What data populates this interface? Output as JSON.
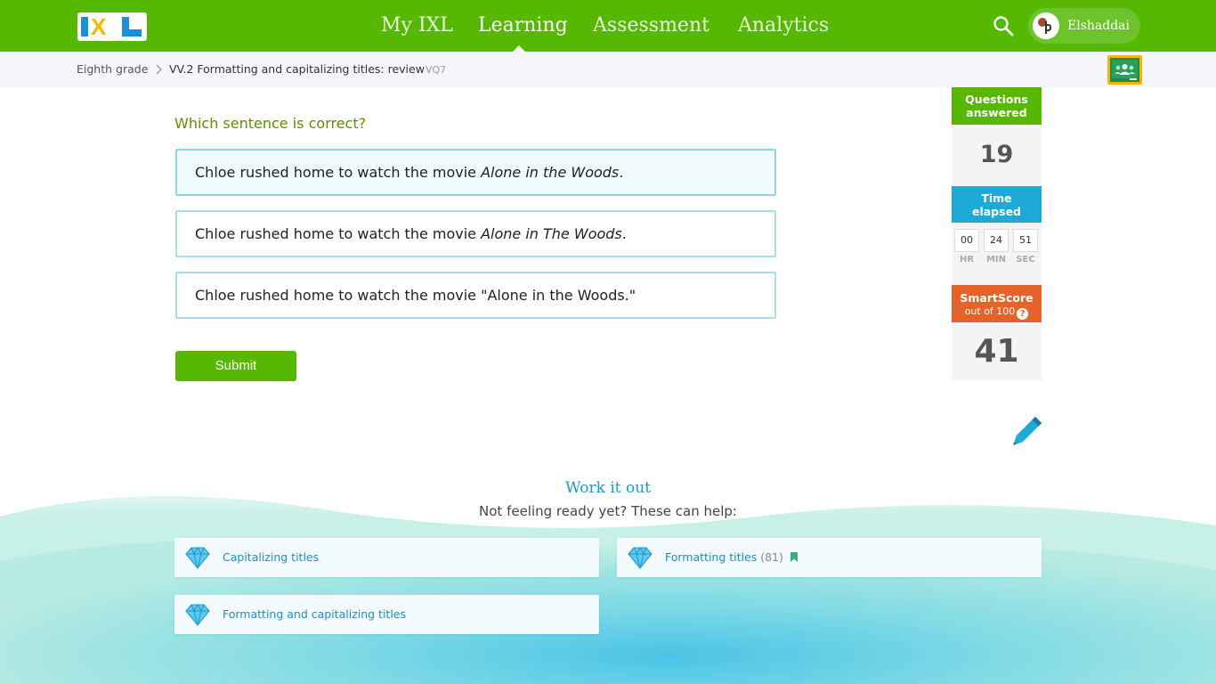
{
  "header": {
    "logo_text": "IXL",
    "nav": [
      "My IXL",
      "Learning",
      "Assessment",
      "Analytics"
    ],
    "active_nav": "Learning",
    "user_name": "Elshaddai"
  },
  "breadcrumb": {
    "grade": "Eighth grade",
    "skill": "VV.2 Formatting and capitalizing titles: review",
    "code": "VQ7"
  },
  "question": {
    "prompt": "Which sentence is correct?",
    "choices": [
      {
        "before": "Chloe rushed home to watch the movie ",
        "italic": "Alone in the Woods",
        "after": "."
      },
      {
        "before": "Chloe rushed home to watch the movie ",
        "italic": "Alone in The Woods",
        "after": "."
      },
      {
        "before": "Chloe rushed home to watch the movie \"Alone in the Woods.\"",
        "italic": "",
        "after": ""
      }
    ],
    "submit_label": "Submit"
  },
  "stats": {
    "questions_label_1": "Questions",
    "questions_label_2": "answered",
    "questions_value": "19",
    "time_label_1": "Time",
    "time_label_2": "elapsed",
    "time_hr": "00",
    "time_min": "24",
    "time_sec": "51",
    "hr_label": "HR",
    "min_label": "MIN",
    "sec_label": "SEC",
    "smartscore_label": "SmartScore",
    "smartscore_sub": "out of 100",
    "smartscore_value": "41",
    "help_glyph": "?"
  },
  "work_it_out": {
    "title": "Work it out",
    "subtitle": "Not feeling ready yet? These can help:",
    "skills": [
      {
        "label": "Capitalizing titles",
        "count": ""
      },
      {
        "label": "Formatting titles",
        "count": "(81)"
      },
      {
        "label": "Formatting and capitalizing titles",
        "count": ""
      }
    ]
  },
  "colors": {
    "brand_green": "#56b800",
    "stat_blue": "#1fa9d6",
    "smartscore_orange": "#e5632a",
    "link_blue": "#1a8fcb"
  },
  "icons": [
    "search-icon",
    "avatar-icon",
    "chevron-right-icon",
    "google-classroom-icon",
    "pencil-icon",
    "diamond-icon",
    "bookmark-icon",
    "help-icon"
  ]
}
